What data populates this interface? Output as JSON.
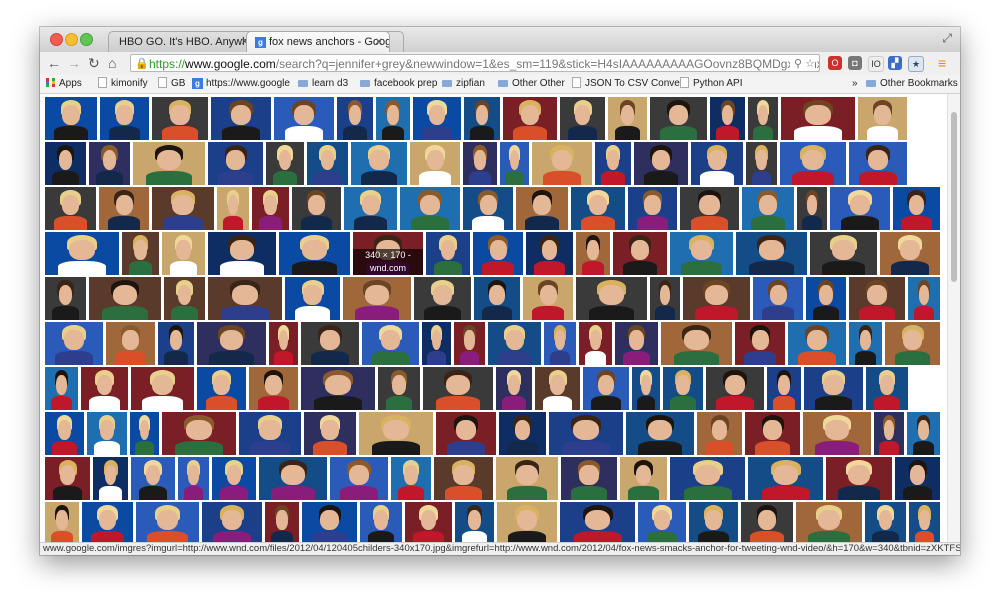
{
  "tabs": [
    {
      "label": "HBO GO. It's HBO. Anywhe"
    },
    {
      "label": "fox news anchors - Googl"
    }
  ],
  "omnibox": {
    "scheme": "https://",
    "host": "www.google.com",
    "path": "/search?q=jennifer+grey&newwindow=1&es_sm=119&stick=H4sIAAAAAAAAAGOovnz8BQMDgxEHnxC..."
  },
  "bookmarks": [
    {
      "label": "Apps",
      "icon": "apps-grid-icon"
    },
    {
      "label": "kimonify",
      "icon": "page-icon"
    },
    {
      "label": "GB",
      "icon": "page-icon"
    },
    {
      "label": "https://www.google",
      "icon": "google-icon"
    },
    {
      "label": "learn d3",
      "icon": "folder-icon"
    },
    {
      "label": "facebook prep",
      "icon": "folder-icon"
    },
    {
      "label": "zipfian",
      "icon": "folder-icon"
    },
    {
      "label": "Other Other",
      "icon": "folder-icon"
    },
    {
      "label": "JSON To CSV Conver",
      "icon": "page-icon"
    },
    {
      "label": "Python API",
      "icon": "page-icon"
    },
    {
      "label": "Other Bookmarks",
      "icon": "folder-icon"
    }
  ],
  "bookmarks_overflow": "»",
  "image_badge": "340 × 170 - wnd.com",
  "status_url": "www.google.com/imgres?imgurl=http://www.wnd.com/files/2012/04/120405childers-340x170.jpg&imgrefurl=http://www.wnd.com/2012/04/fox-news-smacks-anchor-for-tweeting-wnd-video/&h=170&w=340&tbnid=zXKTFSWPp..."
}
